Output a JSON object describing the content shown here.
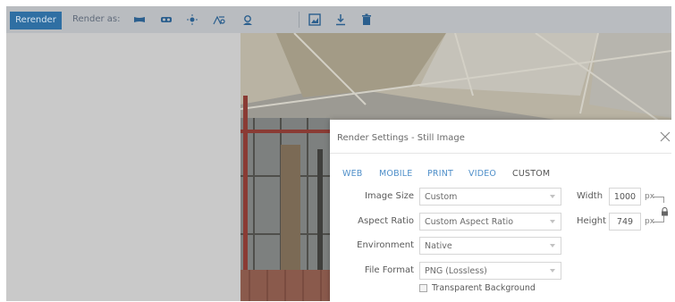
{
  "toolbar": {
    "rerender_label": "Rerender",
    "render_as_label": "Render as:",
    "tools": [
      {
        "icon": "panorama-icon"
      },
      {
        "icon": "vr-goggles-icon"
      },
      {
        "icon": "sun-study-icon"
      },
      {
        "icon": "solar-path-icon"
      },
      {
        "icon": "illuminance-icon"
      },
      {
        "icon": "image-tool-icon"
      },
      {
        "icon": "download-icon"
      },
      {
        "icon": "trash-icon"
      }
    ]
  },
  "dialog": {
    "title": "Render Settings - Still Image",
    "tabs": [
      "WEB",
      "MOBILE",
      "PRINT",
      "VIDEO",
      "CUSTOM"
    ],
    "active_tab": "CUSTOM",
    "fields": {
      "image_size": {
        "label": "Image Size",
        "value": "Custom"
      },
      "aspect_ratio": {
        "label": "Aspect Ratio",
        "value": "Custom Aspect Ratio"
      },
      "environment": {
        "label": "Environment",
        "value": "Native"
      },
      "file_format": {
        "label": "File Format",
        "value": "PNG (Lossless)"
      }
    },
    "width": {
      "label": "Width",
      "value": "1000",
      "unit": "px"
    },
    "height": {
      "label": "Height",
      "value": "749",
      "unit": "px"
    },
    "transparent_background": {
      "label": "Transparent Background",
      "checked": false
    }
  },
  "colors": {
    "accent": "#2f6fa3",
    "tab_link": "#4f8fc9",
    "toolbar_bg": "#b9bcc0"
  }
}
